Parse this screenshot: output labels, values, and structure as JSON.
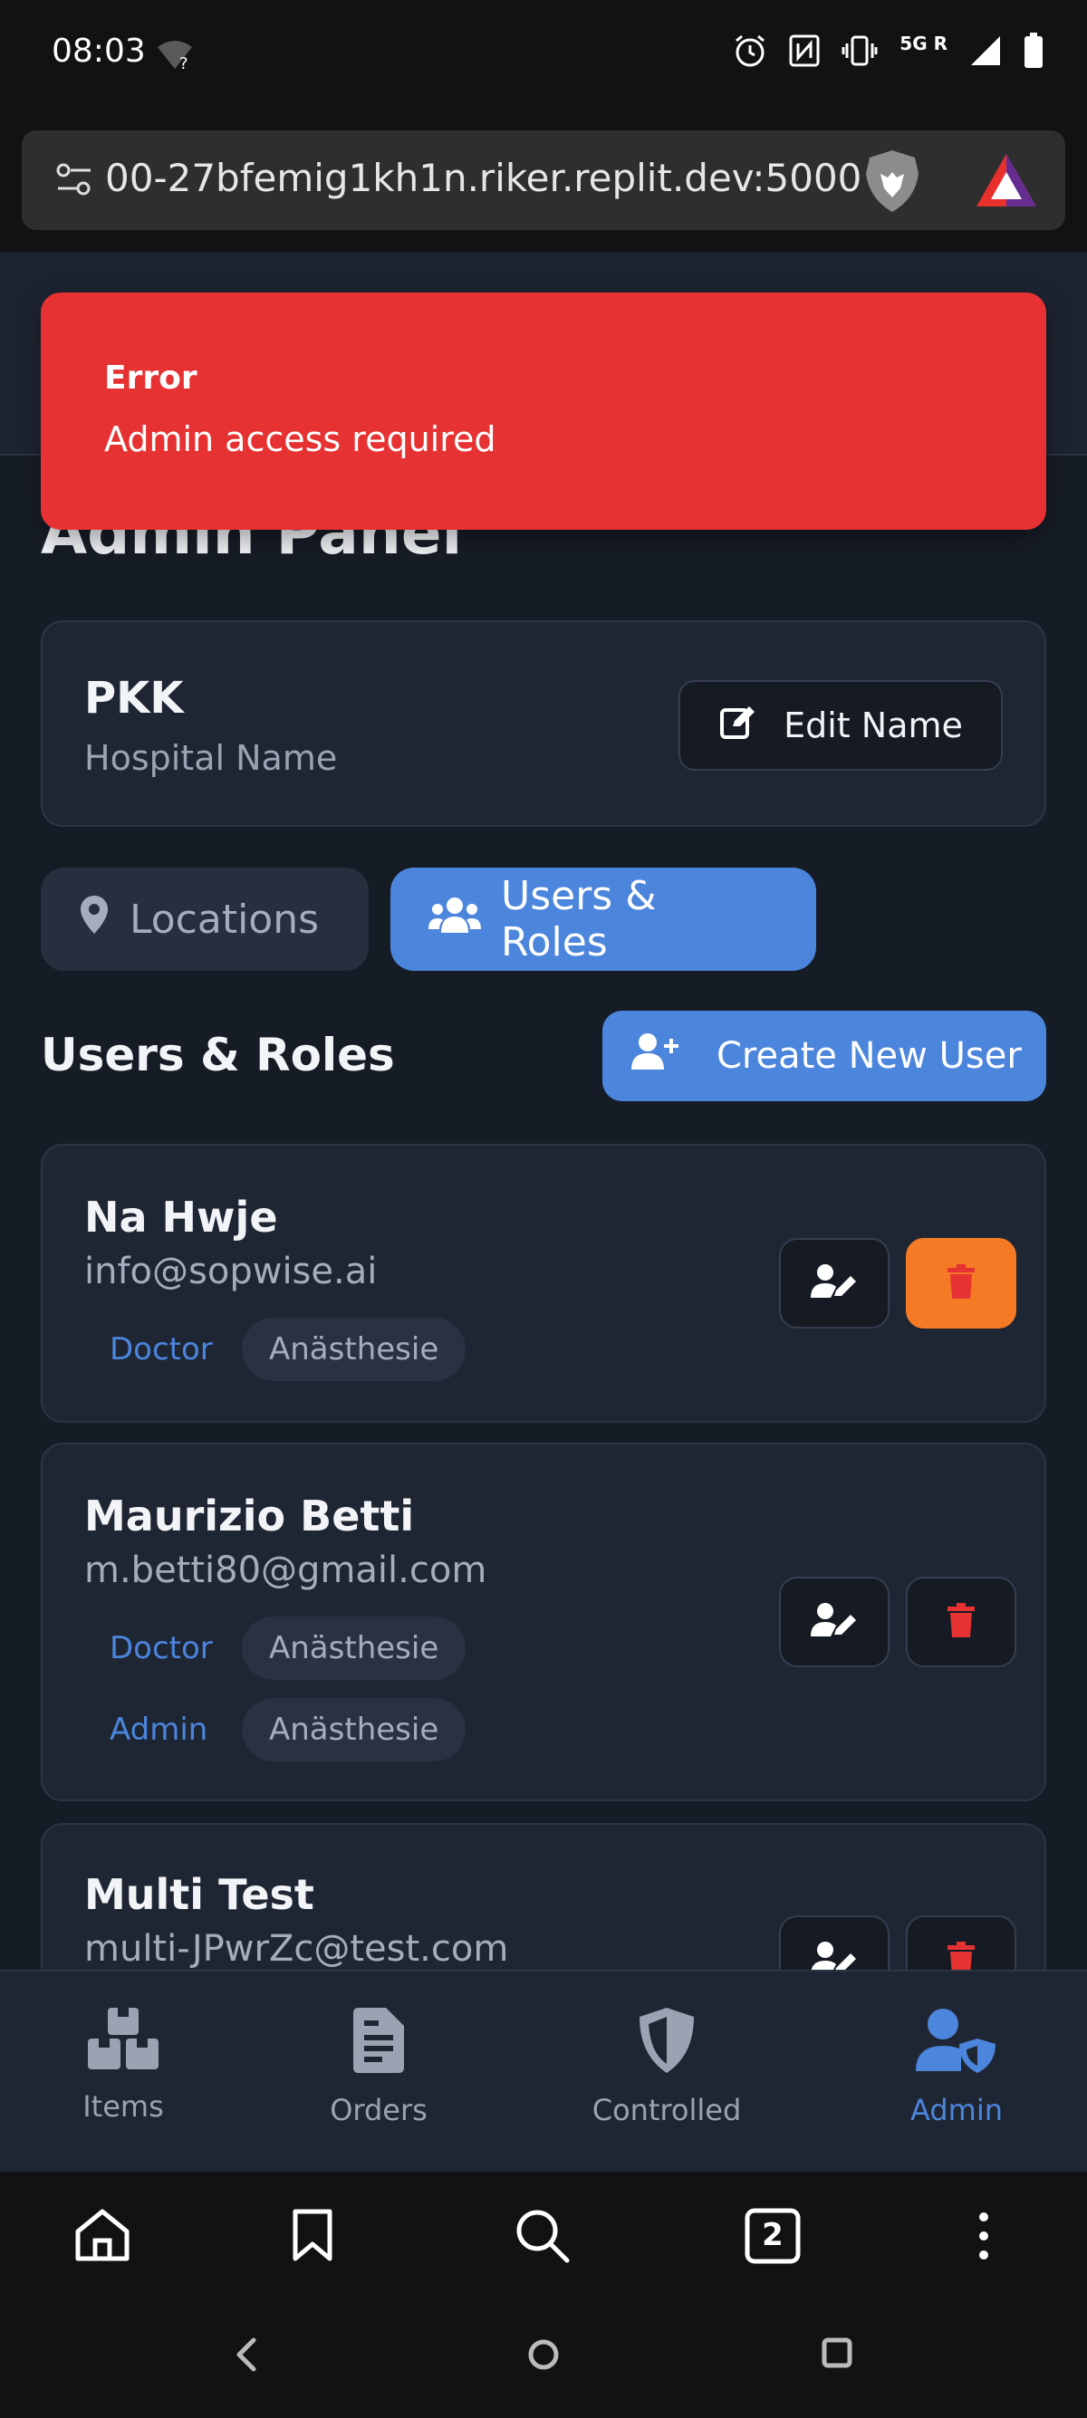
{
  "status_bar": {
    "time": "08:03",
    "network": "5G",
    "roaming": "R"
  },
  "browser": {
    "url": "00-27bfemig1kh1n.riker.replit.dev:5000",
    "tab_count": "2"
  },
  "toast": {
    "title": "Error",
    "message": "Admin access required"
  },
  "page": {
    "title": "Admin Panel"
  },
  "hospital": {
    "name": "PKK",
    "subtitle": "Hospital Name",
    "edit_label": "Edit Name"
  },
  "tabs": [
    {
      "label": "Locations",
      "icon": "map-pin-icon",
      "active": false
    },
    {
      "label": "Users & Roles",
      "icon": "users-icon",
      "active": true
    }
  ],
  "users_section": {
    "title": "Users & Roles",
    "create_label": "Create New User"
  },
  "users": [
    {
      "name": "Na Hwje",
      "email": "info@sopwise.ai",
      "roles": [
        {
          "role": "Doctor",
          "department": "Anästhesie"
        }
      ]
    },
    {
      "name": "Maurizio Betti",
      "email": "m.betti80@gmail.com",
      "roles": [
        {
          "role": "Doctor",
          "department": "Anästhesie"
        },
        {
          "role": "Admin",
          "department": "Anästhesie"
        }
      ]
    },
    {
      "name": "Multi Test",
      "email": "multi-JPwrZc@test.com",
      "roles": []
    }
  ],
  "app_nav": [
    {
      "label": "Items",
      "icon": "boxes-icon",
      "active": false
    },
    {
      "label": "Orders",
      "icon": "document-icon",
      "active": false
    },
    {
      "label": "Controlled",
      "icon": "shield-icon",
      "active": false
    },
    {
      "label": "Admin",
      "icon": "user-shield-icon",
      "active": true
    }
  ],
  "colors": {
    "accent": "#4b85dc",
    "error": "#e63232",
    "delete_orange": "#f47a26",
    "delete_red": "#e63232",
    "background": "#161c26",
    "card": "#1f2633"
  }
}
